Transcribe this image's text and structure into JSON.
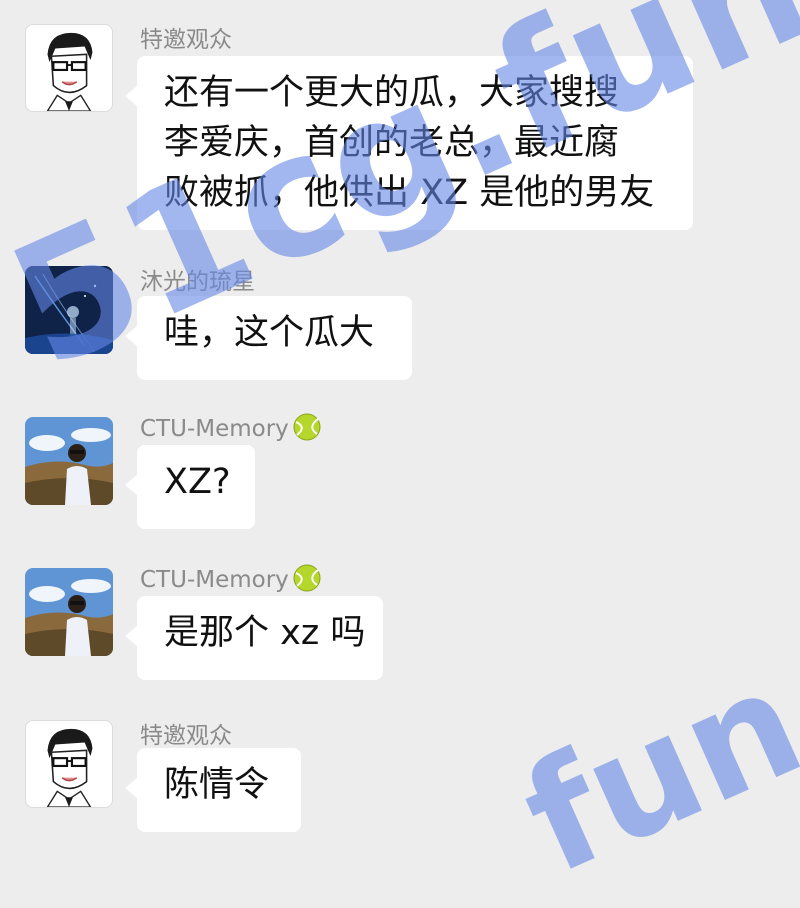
{
  "messages": [
    {
      "sender": "特邀观众",
      "avatar": "cartoon-man-avatar",
      "lines": [
        "还有一个更大的瓜，大家搜搜",
        "李爱庆，首创的老总，最近腐",
        "败被抓，他供出 XZ 是他的男友"
      ]
    },
    {
      "sender": "沐光的琉星",
      "avatar": "night-scene-avatar",
      "lines": [
        "哇，这个瓜大"
      ]
    },
    {
      "sender": "CTU-Memory",
      "sender_emoji": "tennis-ball-icon",
      "avatar": "man-landscape-avatar",
      "lines": [
        "XZ?"
      ]
    },
    {
      "sender": "CTU-Memory",
      "sender_emoji": "tennis-ball-icon",
      "avatar": "man-landscape-avatar",
      "lines": [
        "是那个 xz 吗"
      ]
    },
    {
      "sender": "特邀观众",
      "avatar": "cartoon-man-avatar",
      "lines": [
        "陈情令"
      ]
    }
  ],
  "watermark": {
    "text_top": "51cg.fun",
    "text_bottom": "fun",
    "color": "#6487e6"
  },
  "colors": {
    "background": "#ededed",
    "bubble": "#ffffff",
    "sender_name": "#8a8a8a",
    "message_text": "#111111"
  }
}
